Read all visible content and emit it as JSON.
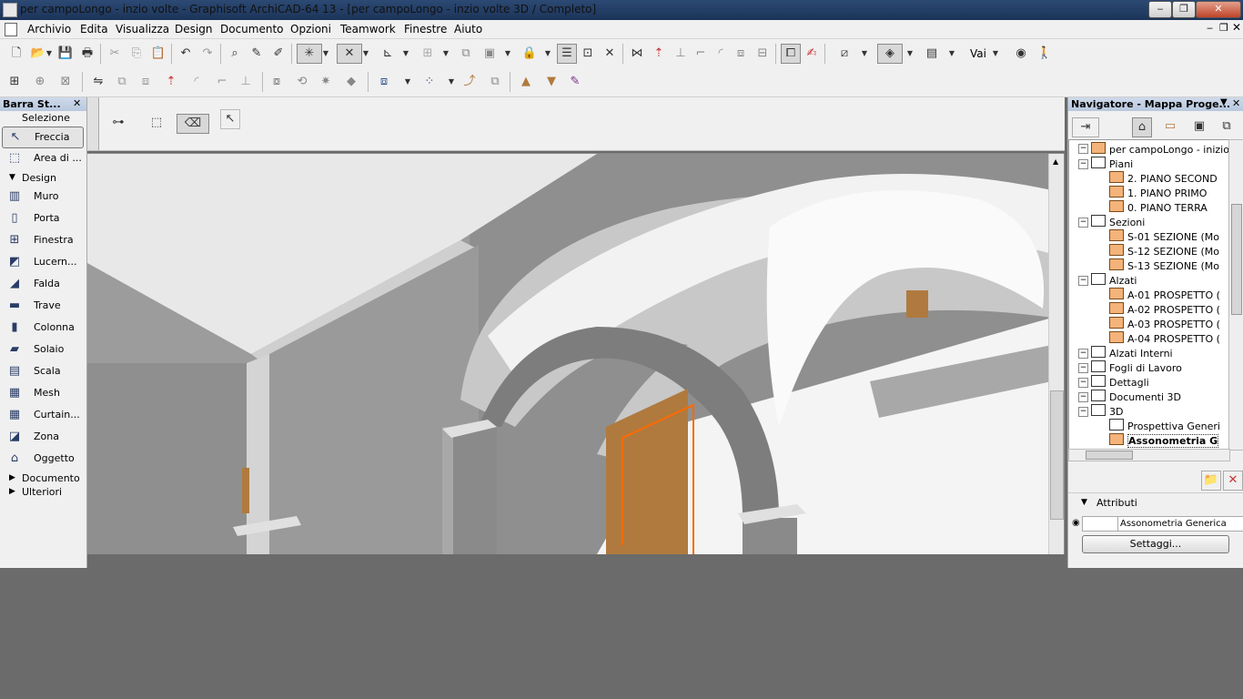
{
  "window": {
    "title": "per campoLongo - inzio volte - Graphisoft ArchiCAD-64 13 - [per campoLongo - inzio volte 3D / Completo]",
    "minimize": "‒",
    "maximize": "❐",
    "close": "✕"
  },
  "menubar": {
    "items": [
      "Archivio",
      "Edita",
      "Visualizza",
      "Design",
      "Documento",
      "Opzioni",
      "Teamwork",
      "Finestre",
      "Aiuto"
    ]
  },
  "toolbar": {
    "goto_label": "Vai"
  },
  "toolbox": {
    "title": "Barra St...",
    "selection_header": "Selezione",
    "arrow_label": "Freccia",
    "area_label": "Area di ...",
    "design_header": "Design",
    "tools": [
      "Muro",
      "Porta",
      "Finestra",
      "Lucern...",
      "Falda",
      "Trave",
      "Colonna",
      "Solaio",
      "Scala",
      "Mesh",
      "Curtain...",
      "Zona",
      "Oggetto"
    ],
    "documento_label": "Documento",
    "ulteriori_label": "Ulteriori"
  },
  "navigator": {
    "title": "Navigatore - Mappa Proge...",
    "root": "per campoLongo - inizio vol",
    "tree": [
      {
        "label": "Piani",
        "level": 1,
        "kind": "folder"
      },
      {
        "label": "2. PIANO SECOND",
        "level": 2,
        "kind": "story"
      },
      {
        "label": "1. PIANO PRIMO",
        "level": 2,
        "kind": "story"
      },
      {
        "label": "0. PIANO TERRA",
        "level": 2,
        "kind": "story"
      },
      {
        "label": "Sezioni",
        "level": 1,
        "kind": "folder"
      },
      {
        "label": "S-01 SEZIONE (Mo",
        "level": 2,
        "kind": "section"
      },
      {
        "label": "S-12 SEZIONE (Mo",
        "level": 2,
        "kind": "section"
      },
      {
        "label": "S-13 SEZIONE (Mo",
        "level": 2,
        "kind": "section"
      },
      {
        "label": "Alzati",
        "level": 1,
        "kind": "folder"
      },
      {
        "label": "A-01 PROSPETTO (",
        "level": 2,
        "kind": "section"
      },
      {
        "label": "A-02 PROSPETTO (",
        "level": 2,
        "kind": "section"
      },
      {
        "label": "A-03 PROSPETTO (",
        "level": 2,
        "kind": "section"
      },
      {
        "label": "A-04 PROSPETTO (",
        "level": 2,
        "kind": "section"
      },
      {
        "label": "Alzati Interni",
        "level": 1,
        "kind": "folder"
      },
      {
        "label": "Fogli di Lavoro",
        "level": 1,
        "kind": "folder"
      },
      {
        "label": "Dettagli",
        "level": 1,
        "kind": "folder"
      },
      {
        "label": "Documenti 3D",
        "level": 1,
        "kind": "folder"
      },
      {
        "label": "3D",
        "level": 1,
        "kind": "folder"
      },
      {
        "label": "Prospettiva Generi",
        "level": 2,
        "kind": "camera"
      },
      {
        "label": "Assonometria G",
        "level": 2,
        "kind": "axo",
        "selected": true
      }
    ],
    "attributes_header": "Attributi",
    "attribute_value": "Assonometria Generica",
    "settings_button": "Settaggi..."
  },
  "colors": {
    "title_bar": "#1c3458",
    "chrome": "#f0f0f0",
    "door_wood": "#b07a3e",
    "door_highlight": "#ff6a00",
    "wall_gray": "#9a9a9a"
  }
}
